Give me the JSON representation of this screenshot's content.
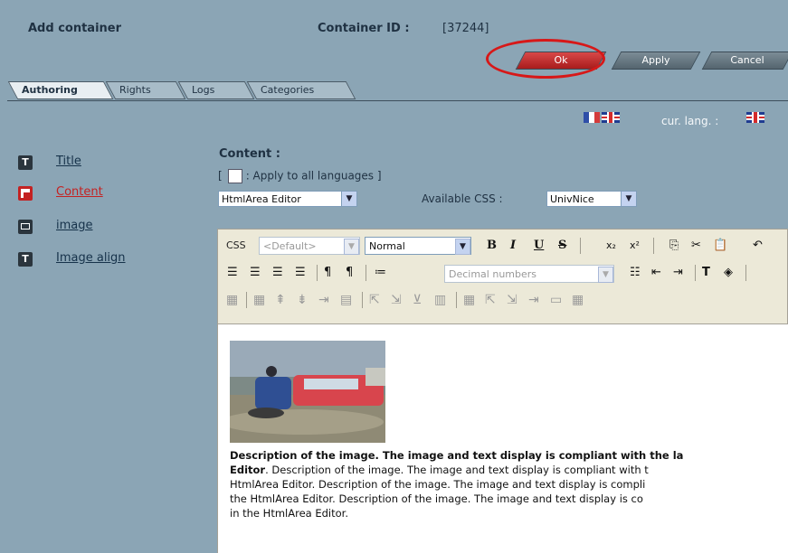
{
  "header": {
    "title": "Add container",
    "container_id_label": "Container ID :",
    "container_id_value": "[37244]"
  },
  "buttons": {
    "ok": "Ok",
    "apply": "Apply",
    "cancel": "Cancel"
  },
  "tabs": [
    {
      "label": "Authoring",
      "active": true
    },
    {
      "label": "Rights",
      "active": false
    },
    {
      "label": "Logs",
      "active": false
    },
    {
      "label": "Categories",
      "active": false
    }
  ],
  "language": {
    "current_label": "cur. lang. :"
  },
  "nav": [
    {
      "label": "Title",
      "icon": "text-icon"
    },
    {
      "label": "Content",
      "icon": "content-icon",
      "active": true
    },
    {
      "label": "image",
      "icon": "image-icon"
    },
    {
      "label": "Image align",
      "icon": "text-icon"
    }
  ],
  "content": {
    "label": "Content :",
    "apply_all_prefix": "[",
    "apply_all_label": ": Apply to all languages",
    "apply_all_suffix": "]",
    "editor_select": "HtmlArea Editor",
    "css_label": "Available CSS :",
    "css_select": "UnivNice"
  },
  "toolbar": {
    "css_label": "CSS",
    "style_select": "<Default>",
    "format_select": "Normal",
    "list_select": "Decimal numbers"
  },
  "editor_text": {
    "line1_bold": "Description of the image. The image and text display is compliant with the la",
    "line2_bold": "Editor",
    "line2_rest": ". Description of the image. The image and text display is compliant with t",
    "line3": "HtmlArea Editor. Description of the image. The image and text display is compli",
    "line4": "the HtmlArea Editor. Description of the image. The image and text display is co",
    "line5": "in the HtmlArea Editor."
  },
  "colors": {
    "background": "#8ba5b5",
    "ok_button": "#c42222",
    "highlight_ring": "#d71818",
    "active_nav": "#c42222"
  }
}
